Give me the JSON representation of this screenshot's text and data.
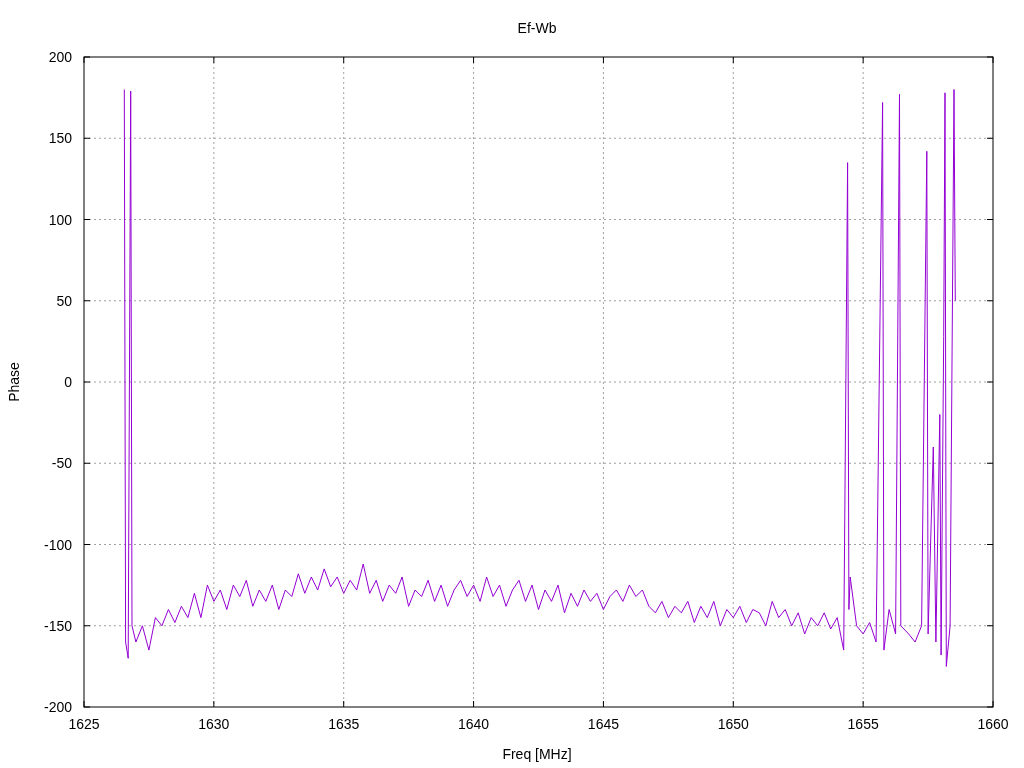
{
  "chart_data": {
    "type": "line",
    "title": "Ef-Wb",
    "xlabel": "Freq [MHz]",
    "ylabel": "Phase",
    "x": [
      1626.55,
      1626.6,
      1626.7,
      1626.8,
      1626.85,
      1627,
      1627.25,
      1627.5,
      1627.75,
      1628,
      1628.25,
      1628.5,
      1628.75,
      1629,
      1629.25,
      1629.5,
      1629.75,
      1630,
      1630.25,
      1630.5,
      1630.75,
      1631,
      1631.25,
      1631.5,
      1631.75,
      1632,
      1632.25,
      1632.5,
      1632.75,
      1633,
      1633.25,
      1633.5,
      1633.75,
      1634,
      1634.25,
      1634.5,
      1634.75,
      1635,
      1635.25,
      1635.5,
      1635.75,
      1636,
      1636.25,
      1636.5,
      1636.75,
      1637,
      1637.25,
      1637.5,
      1637.75,
      1638,
      1638.25,
      1638.5,
      1638.75,
      1639,
      1639.25,
      1639.5,
      1639.75,
      1640,
      1640.25,
      1640.5,
      1640.75,
      1641,
      1641.25,
      1641.5,
      1641.75,
      1642,
      1642.25,
      1642.5,
      1642.75,
      1643,
      1643.25,
      1643.5,
      1643.75,
      1644,
      1644.25,
      1644.5,
      1644.75,
      1645,
      1645.25,
      1645.5,
      1645.75,
      1646,
      1646.25,
      1646.5,
      1646.75,
      1647,
      1647.25,
      1647.5,
      1647.75,
      1648,
      1648.25,
      1648.5,
      1648.75,
      1649,
      1649.25,
      1649.5,
      1649.75,
      1650,
      1650.25,
      1650.5,
      1650.75,
      1651,
      1651.25,
      1651.5,
      1651.75,
      1652,
      1652.25,
      1652.5,
      1652.75,
      1653,
      1653.25,
      1653.5,
      1653.75,
      1654,
      1654.25,
      1654.4,
      1654.45,
      1654.5,
      1654.75,
      1655,
      1655.25,
      1655.5,
      1655.75,
      1655.8,
      1656,
      1656.25,
      1656.4,
      1656.45,
      1656.75,
      1657,
      1657.25,
      1657.45,
      1657.5,
      1657.7,
      1657.8,
      1657.95,
      1658,
      1658.1,
      1658.15,
      1658.2,
      1658.35,
      1658.5,
      1658.55
    ],
    "series": [
      {
        "color": "#9400d3",
        "values": [
          180,
          -160,
          -170,
          179,
          -150,
          -160,
          -150,
          -165,
          -145,
          -150,
          -140,
          -148,
          -138,
          -145,
          -130,
          -145,
          -125,
          -135,
          -128,
          -140,
          -125,
          -132,
          -122,
          -138,
          -128,
          -135,
          -125,
          -140,
          -128,
          -132,
          -118,
          -130,
          -120,
          -128,
          -115,
          -126,
          -120,
          -130,
          -122,
          -128,
          -112,
          -130,
          -122,
          -135,
          -125,
          -130,
          -120,
          -138,
          -128,
          -132,
          -122,
          -135,
          -125,
          -138,
          -128,
          -122,
          -132,
          -125,
          -135,
          -120,
          -132,
          -125,
          -138,
          -128,
          -122,
          -135,
          -125,
          -140,
          -128,
          -135,
          -125,
          -142,
          -130,
          -138,
          -128,
          -135,
          -130,
          -140,
          -132,
          -128,
          -135,
          -125,
          -132,
          -128,
          -138,
          -142,
          -135,
          -145,
          -138,
          -142,
          -135,
          -148,
          -138,
          -145,
          -135,
          -150,
          -140,
          -145,
          -138,
          -148,
          -140,
          -142,
          -150,
          -135,
          -145,
          -140,
          -150,
          -142,
          -155,
          -145,
          -150,
          -142,
          -152,
          -145,
          -165,
          135,
          -140,
          -120,
          -150,
          -155,
          -148,
          -160,
          172,
          -165,
          -140,
          -155,
          177,
          -150,
          -155,
          -160,
          -150,
          142,
          -155,
          -40,
          -160,
          -20,
          -168,
          28,
          178,
          -175,
          -150,
          180,
          50
        ]
      }
    ],
    "xlim": [
      1625,
      1660
    ],
    "ylim": [
      -200,
      200
    ],
    "xticks": [
      1625,
      1630,
      1635,
      1640,
      1645,
      1650,
      1655,
      1660
    ],
    "yticks": [
      -200,
      -150,
      -100,
      -50,
      0,
      50,
      100,
      150,
      200
    ],
    "grid": true
  }
}
